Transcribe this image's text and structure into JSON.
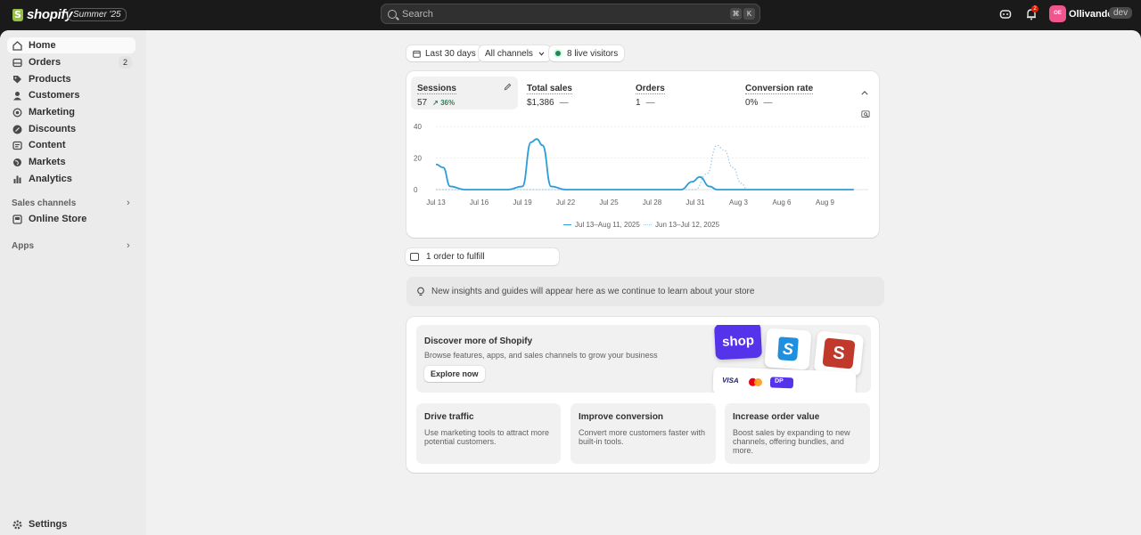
{
  "topbar": {
    "logo_text": "shopify",
    "edition": "Summer '25",
    "search_placeholder": "Search",
    "shortcut_cmd": "⌘",
    "shortcut_key": "K",
    "notification_count": "2",
    "avatar_initials": "OE",
    "store_name": "Ollivanders",
    "store_badge": "dev"
  },
  "sidebar": {
    "items": [
      {
        "label": "Home",
        "icon": "home-icon"
      },
      {
        "label": "Orders",
        "icon": "inbox-icon",
        "badge": "2"
      },
      {
        "label": "Products",
        "icon": "tag-icon"
      },
      {
        "label": "Customers",
        "icon": "person-icon"
      },
      {
        "label": "Marketing",
        "icon": "target-icon"
      },
      {
        "label": "Discounts",
        "icon": "discount-icon"
      },
      {
        "label": "Content",
        "icon": "content-icon"
      },
      {
        "label": "Markets",
        "icon": "globe-icon"
      },
      {
        "label": "Analytics",
        "icon": "bar-chart-icon"
      }
    ],
    "sales_channels_title": "Sales channels",
    "online_store": "Online Store",
    "apps_title": "Apps",
    "settings": "Settings"
  },
  "filters": {
    "date_range": "Last 30 days",
    "channel": "All channels",
    "live_visitors": "8 live visitors"
  },
  "metrics": [
    {
      "label": "Sessions",
      "value": "57",
      "trend": "36%"
    },
    {
      "label": "Total sales",
      "value": "$1,386",
      "trend": "—"
    },
    {
      "label": "Orders",
      "value": "1",
      "trend": "—"
    },
    {
      "label": "Conversion rate",
      "value": "0%",
      "trend": "—"
    }
  ],
  "chart_data": {
    "type": "line",
    "x": [
      "Jul 13",
      "Jul 16",
      "Jul 19",
      "Jul 22",
      "Jul 25",
      "Jul 28",
      "Jul 31",
      "Aug 3",
      "Aug 6",
      "Aug 9"
    ],
    "yticks": [
      "40",
      "20",
      "0"
    ],
    "ylim": [
      0,
      40
    ],
    "series": [
      {
        "name": "Jul 13–Aug 11, 2025",
        "color": "#2b9dd9",
        "style": "solid",
        "points": [
          [
            0,
            16
          ],
          [
            0.5,
            14
          ],
          [
            1,
            2
          ],
          [
            2,
            0
          ],
          [
            5,
            0
          ],
          [
            6,
            2
          ],
          [
            6.6,
            30
          ],
          [
            7,
            32
          ],
          [
            7.4,
            28
          ],
          [
            8,
            2
          ],
          [
            9,
            0
          ],
          [
            17,
            0
          ],
          [
            17.8,
            5
          ],
          [
            18.3,
            8
          ],
          [
            19,
            2
          ],
          [
            19.5,
            0
          ],
          [
            29,
            0
          ]
        ]
      },
      {
        "name": "Jun 13–Jul 12, 2025",
        "color": "#9fc6e3",
        "style": "dotted",
        "points": [
          [
            0,
            0
          ],
          [
            18,
            0
          ],
          [
            18.8,
            10
          ],
          [
            19.5,
            28
          ],
          [
            20,
            25
          ],
          [
            20.6,
            14
          ],
          [
            21.2,
            4
          ],
          [
            21.6,
            0
          ]
        ]
      }
    ],
    "grid": true,
    "legend": "bottom-center"
  },
  "fulfill": "1 order to fulfill",
  "insight": "New insights and guides will appear here as we continue to learn about your store",
  "discover": {
    "title": "Discover more of Shopify",
    "subtitle": "Browse features, apps, and sales channels to grow your business",
    "button": "Explore now",
    "tile_shop": "shop",
    "tile_bag": "S",
    "tile_s": "S",
    "pay_visa": "VISA",
    "pay_other": "DP"
  },
  "tiles": [
    {
      "title": "Drive traffic",
      "text": "Use marketing tools to attract more potential customers."
    },
    {
      "title": "Improve conversion",
      "text": "Convert more customers faster with built-in tools."
    },
    {
      "title": "Increase order value",
      "text": "Boost sales by expanding to new channels, offering bundles, and more."
    }
  ]
}
